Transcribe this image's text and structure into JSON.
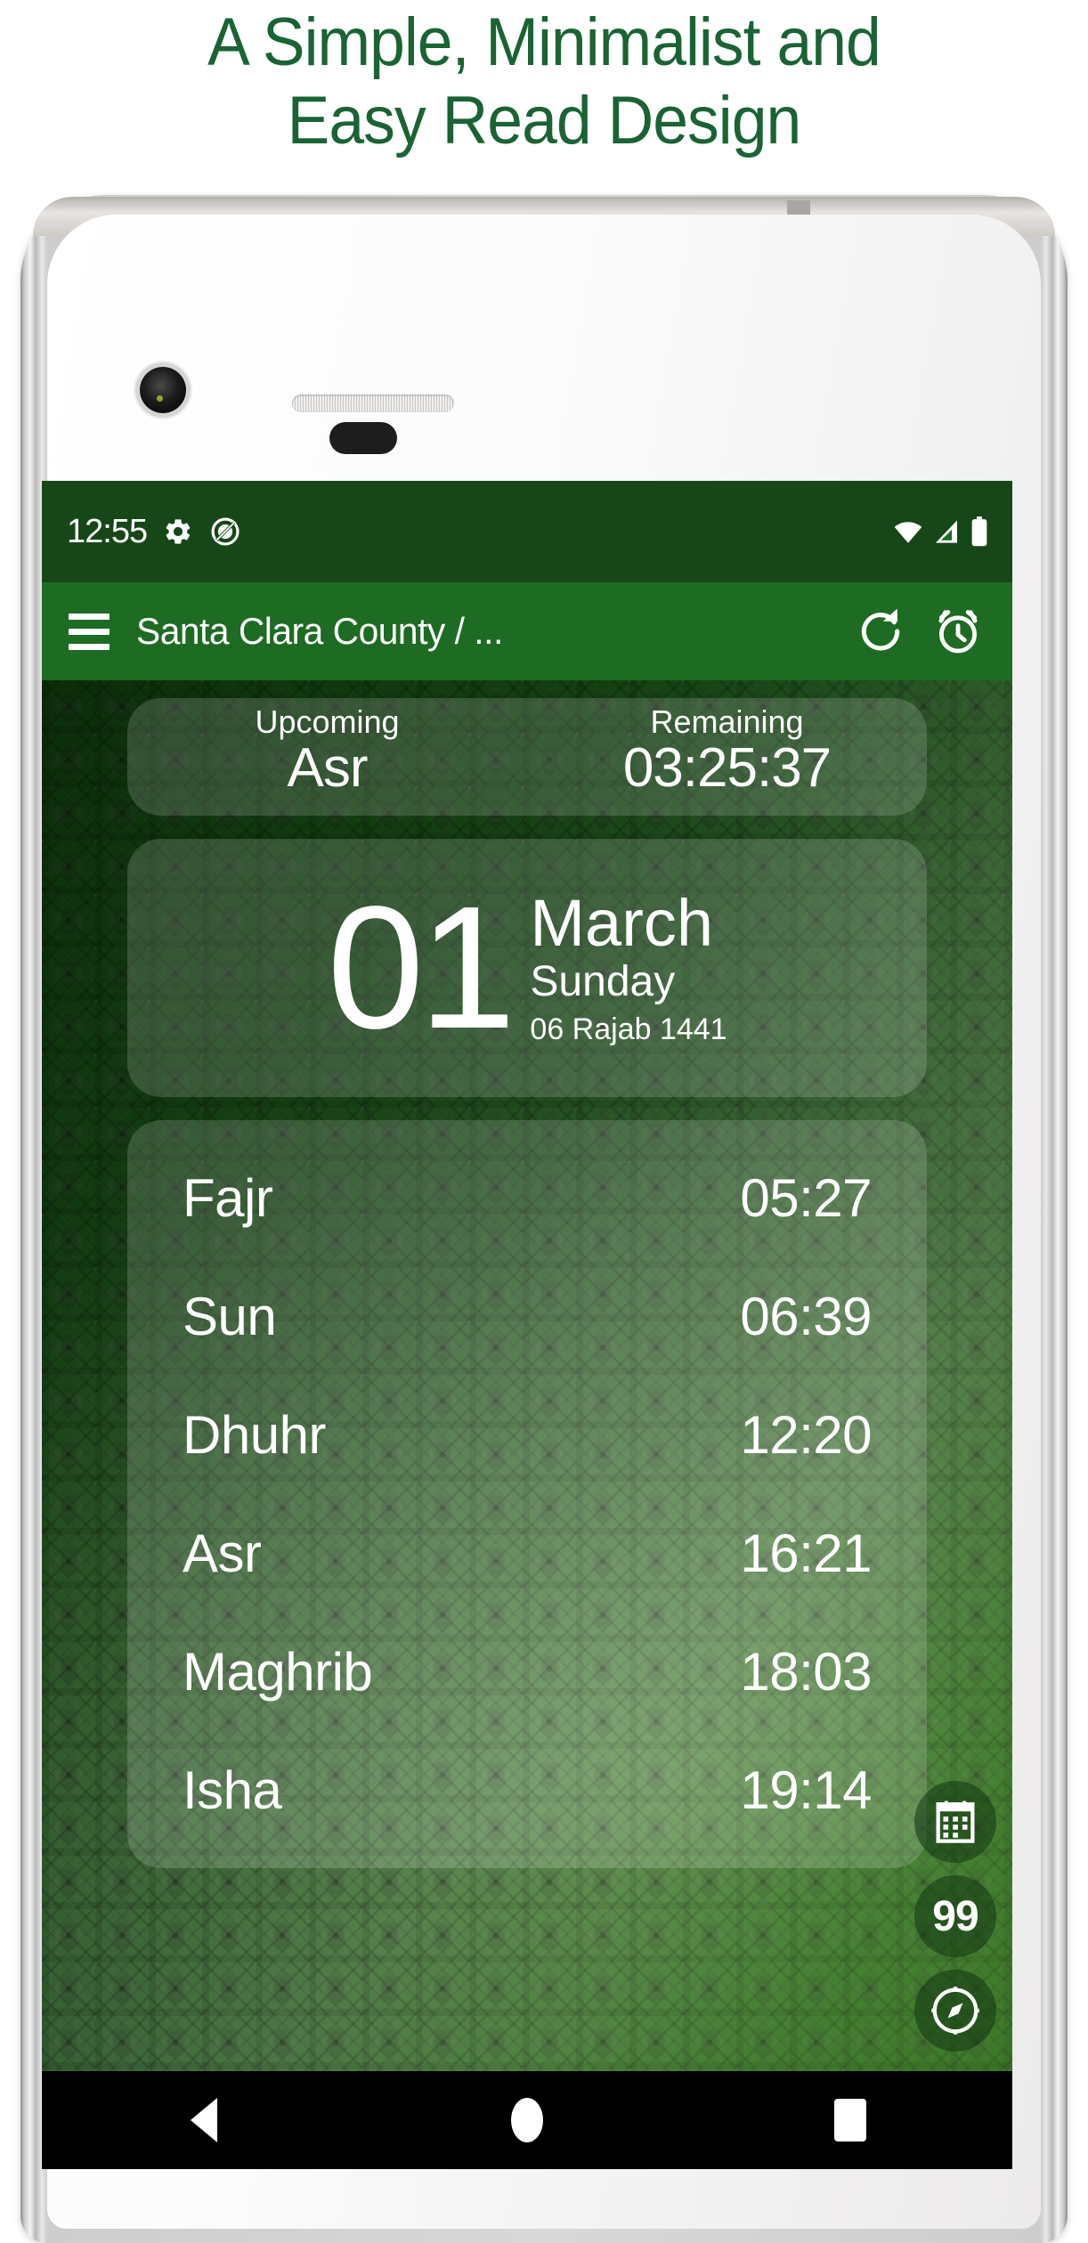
{
  "promo": {
    "line1": "A Simple, Minimalist  and",
    "line2": "Easy Read Design",
    "color": "#1a6334"
  },
  "status_bar": {
    "time": "12:55",
    "icons": [
      "gear-icon",
      "do-not-disturb-icon"
    ],
    "right_icons": [
      "wifi-icon",
      "signal-icon",
      "battery-icon"
    ],
    "background": "#174718"
  },
  "app_bar": {
    "menu_icon": "hamburger-menu-icon",
    "title": "Santa Clara County / ...",
    "refresh_icon": "refresh-icon",
    "alarm_icon": "alarm-clock-icon",
    "background": "#1e6b23"
  },
  "upcoming_card": {
    "upcoming_label": "Upcoming",
    "upcoming_value": "Asr",
    "remaining_label": "Remaining",
    "remaining_value": "03:25:37"
  },
  "date_card": {
    "day": "01",
    "month": "March",
    "weekday": "Sunday",
    "hijri": "06 Rajab 1441"
  },
  "prayer_times": [
    {
      "name": "Fajr",
      "time": "05:27"
    },
    {
      "name": "Sun",
      "time": "06:39"
    },
    {
      "name": "Dhuhr",
      "time": "12:20"
    },
    {
      "name": "Asr",
      "time": "16:21"
    },
    {
      "name": "Maghrib",
      "time": "18:03"
    },
    {
      "name": "Isha",
      "time": "19:14"
    }
  ],
  "fabs": [
    {
      "name": "calendar-fab",
      "icon": "calendar-icon",
      "label": ""
    },
    {
      "name": "tasbih-fab",
      "icon": "counter-icon",
      "label": "99"
    },
    {
      "name": "qibla-fab",
      "icon": "compass-icon",
      "label": ""
    }
  ],
  "nav_bar": {
    "back": "back-nav-button",
    "home": "home-nav-button",
    "recents": "recents-nav-button"
  }
}
